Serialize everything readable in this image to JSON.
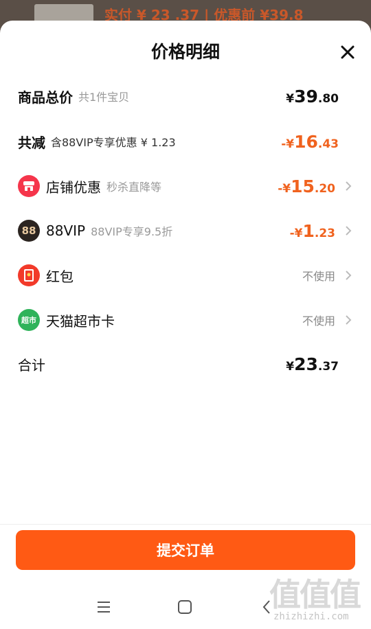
{
  "background": {
    "banner_text": "实付 ¥ 23 .37 | 优惠前 ¥39.8"
  },
  "sheet": {
    "title": "价格明细"
  },
  "rows": {
    "total_goods": {
      "label": "商品总价",
      "sub": "共1件宝贝",
      "amount": {
        "yen": "¥",
        "int": "39",
        "dec": ".80"
      }
    },
    "total_discount": {
      "label": "共减",
      "sub": "含88VIP专享优惠 ¥ 1.23",
      "amount": {
        "yen": "-¥",
        "int": "16",
        "dec": ".43"
      }
    },
    "store_discount": {
      "label": "店铺优惠",
      "sub": "秒杀直降等",
      "amount": {
        "yen": "-¥",
        "int": "15",
        "dec": ".20"
      },
      "icon": "store-icon"
    },
    "vip88": {
      "label": "88VIP",
      "sub": "88VIP专享9.5折",
      "amount": {
        "yen": "-¥",
        "int": "1",
        "dec": ".23"
      },
      "icon": "88vip-icon",
      "icon_text": "88"
    },
    "red_packet": {
      "label": "红包",
      "status": "不使用",
      "icon": "red-packet-icon"
    },
    "tmall_card": {
      "label": "天猫超市卡",
      "status": "不使用",
      "icon": "supermarket-card-icon",
      "icon_text": "超市"
    },
    "sum": {
      "label": "合计",
      "amount": {
        "yen": "¥",
        "int": "23",
        "dec": ".37"
      }
    }
  },
  "actions": {
    "submit_label": "提交订单"
  },
  "watermark": {
    "glyphs": "值值值",
    "url": "zhizhizhi.com"
  },
  "colors": {
    "accent": "#ff5a14",
    "discount": "#f0621e",
    "store_icon": "#f5354b",
    "vip_icon": "#2b2420",
    "red_packet_icon": "#f23a2a",
    "tmall_card_icon": "#2fb35a"
  }
}
